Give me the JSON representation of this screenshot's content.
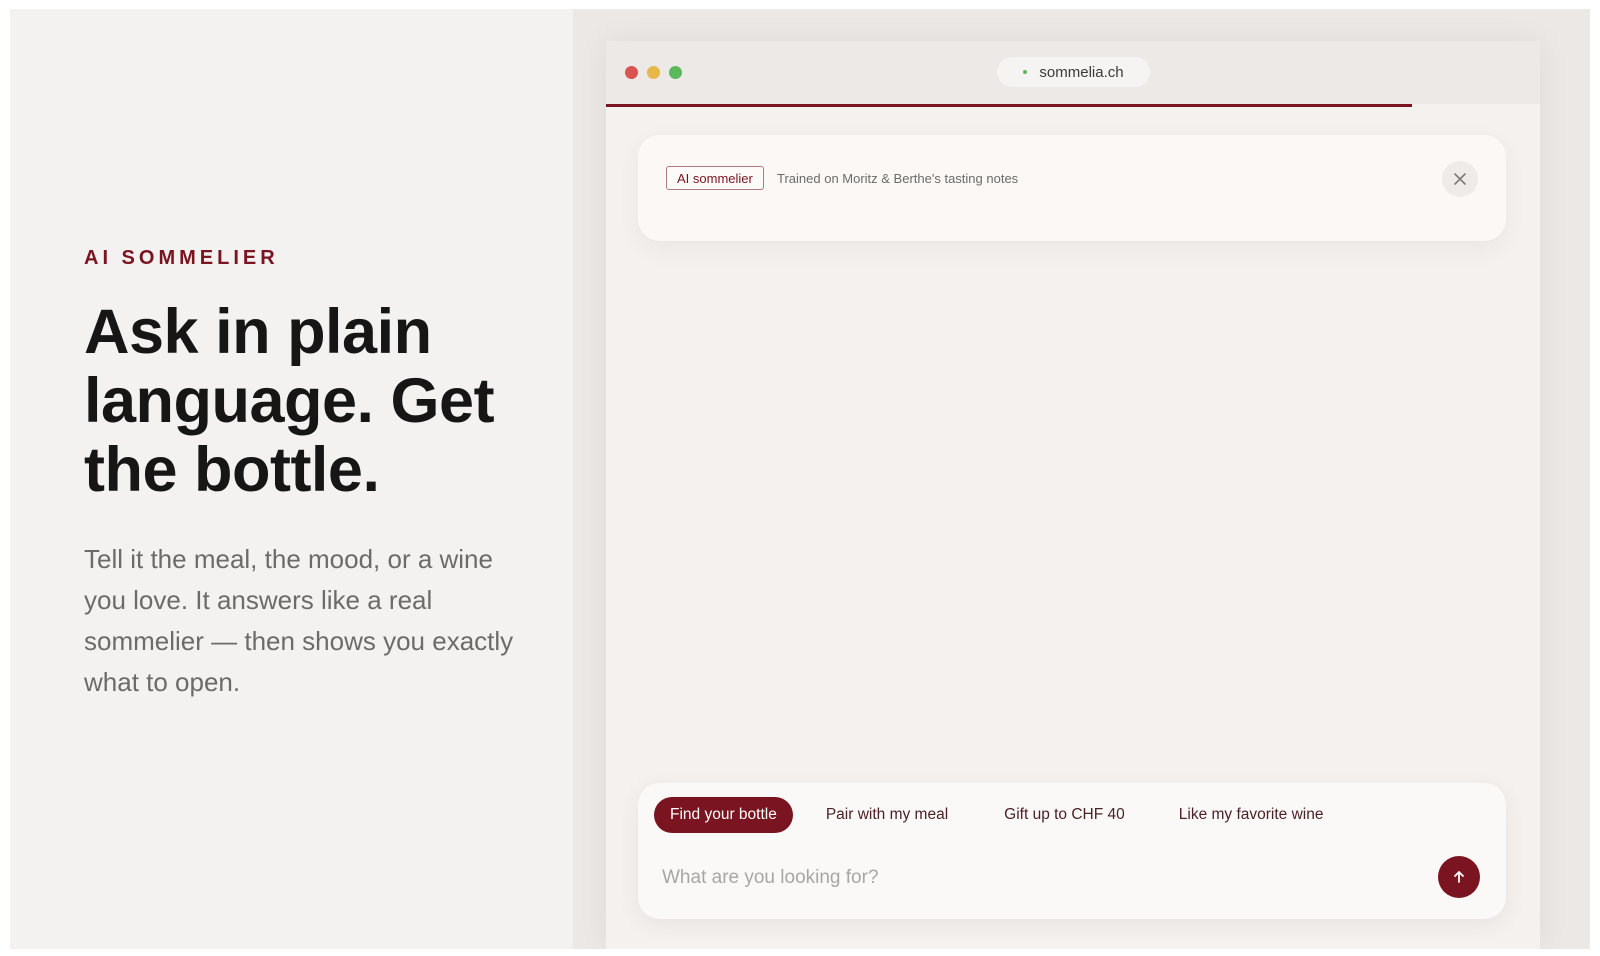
{
  "hero": {
    "eyebrow": "AI SOMMELIER",
    "headline": "Ask in plain language. Get the bottle.",
    "subtext": "Tell it the meal, the mood, or a wine you love. It answers like a real sommelier — then shows you exactly what to open."
  },
  "browser": {
    "url": "sommelia.ch",
    "banner": {
      "badge": "AI sommelier",
      "note": "Trained on Moritz & Berthe's tasting notes",
      "close_icon": "close-icon"
    },
    "chat": {
      "chips": [
        {
          "label": "Find your bottle",
          "active": true
        },
        {
          "label": "Pair with my meal",
          "active": false
        },
        {
          "label": "Gift up to CHF 40",
          "active": false
        },
        {
          "label": "Like my favorite wine",
          "active": false
        }
      ],
      "placeholder": "What are you looking for?",
      "send_icon": "arrow-up-icon"
    }
  },
  "colors": {
    "accent": "#7a1420",
    "left_bg": "#f3f2f1",
    "right_bg": "#ebe8e5"
  }
}
